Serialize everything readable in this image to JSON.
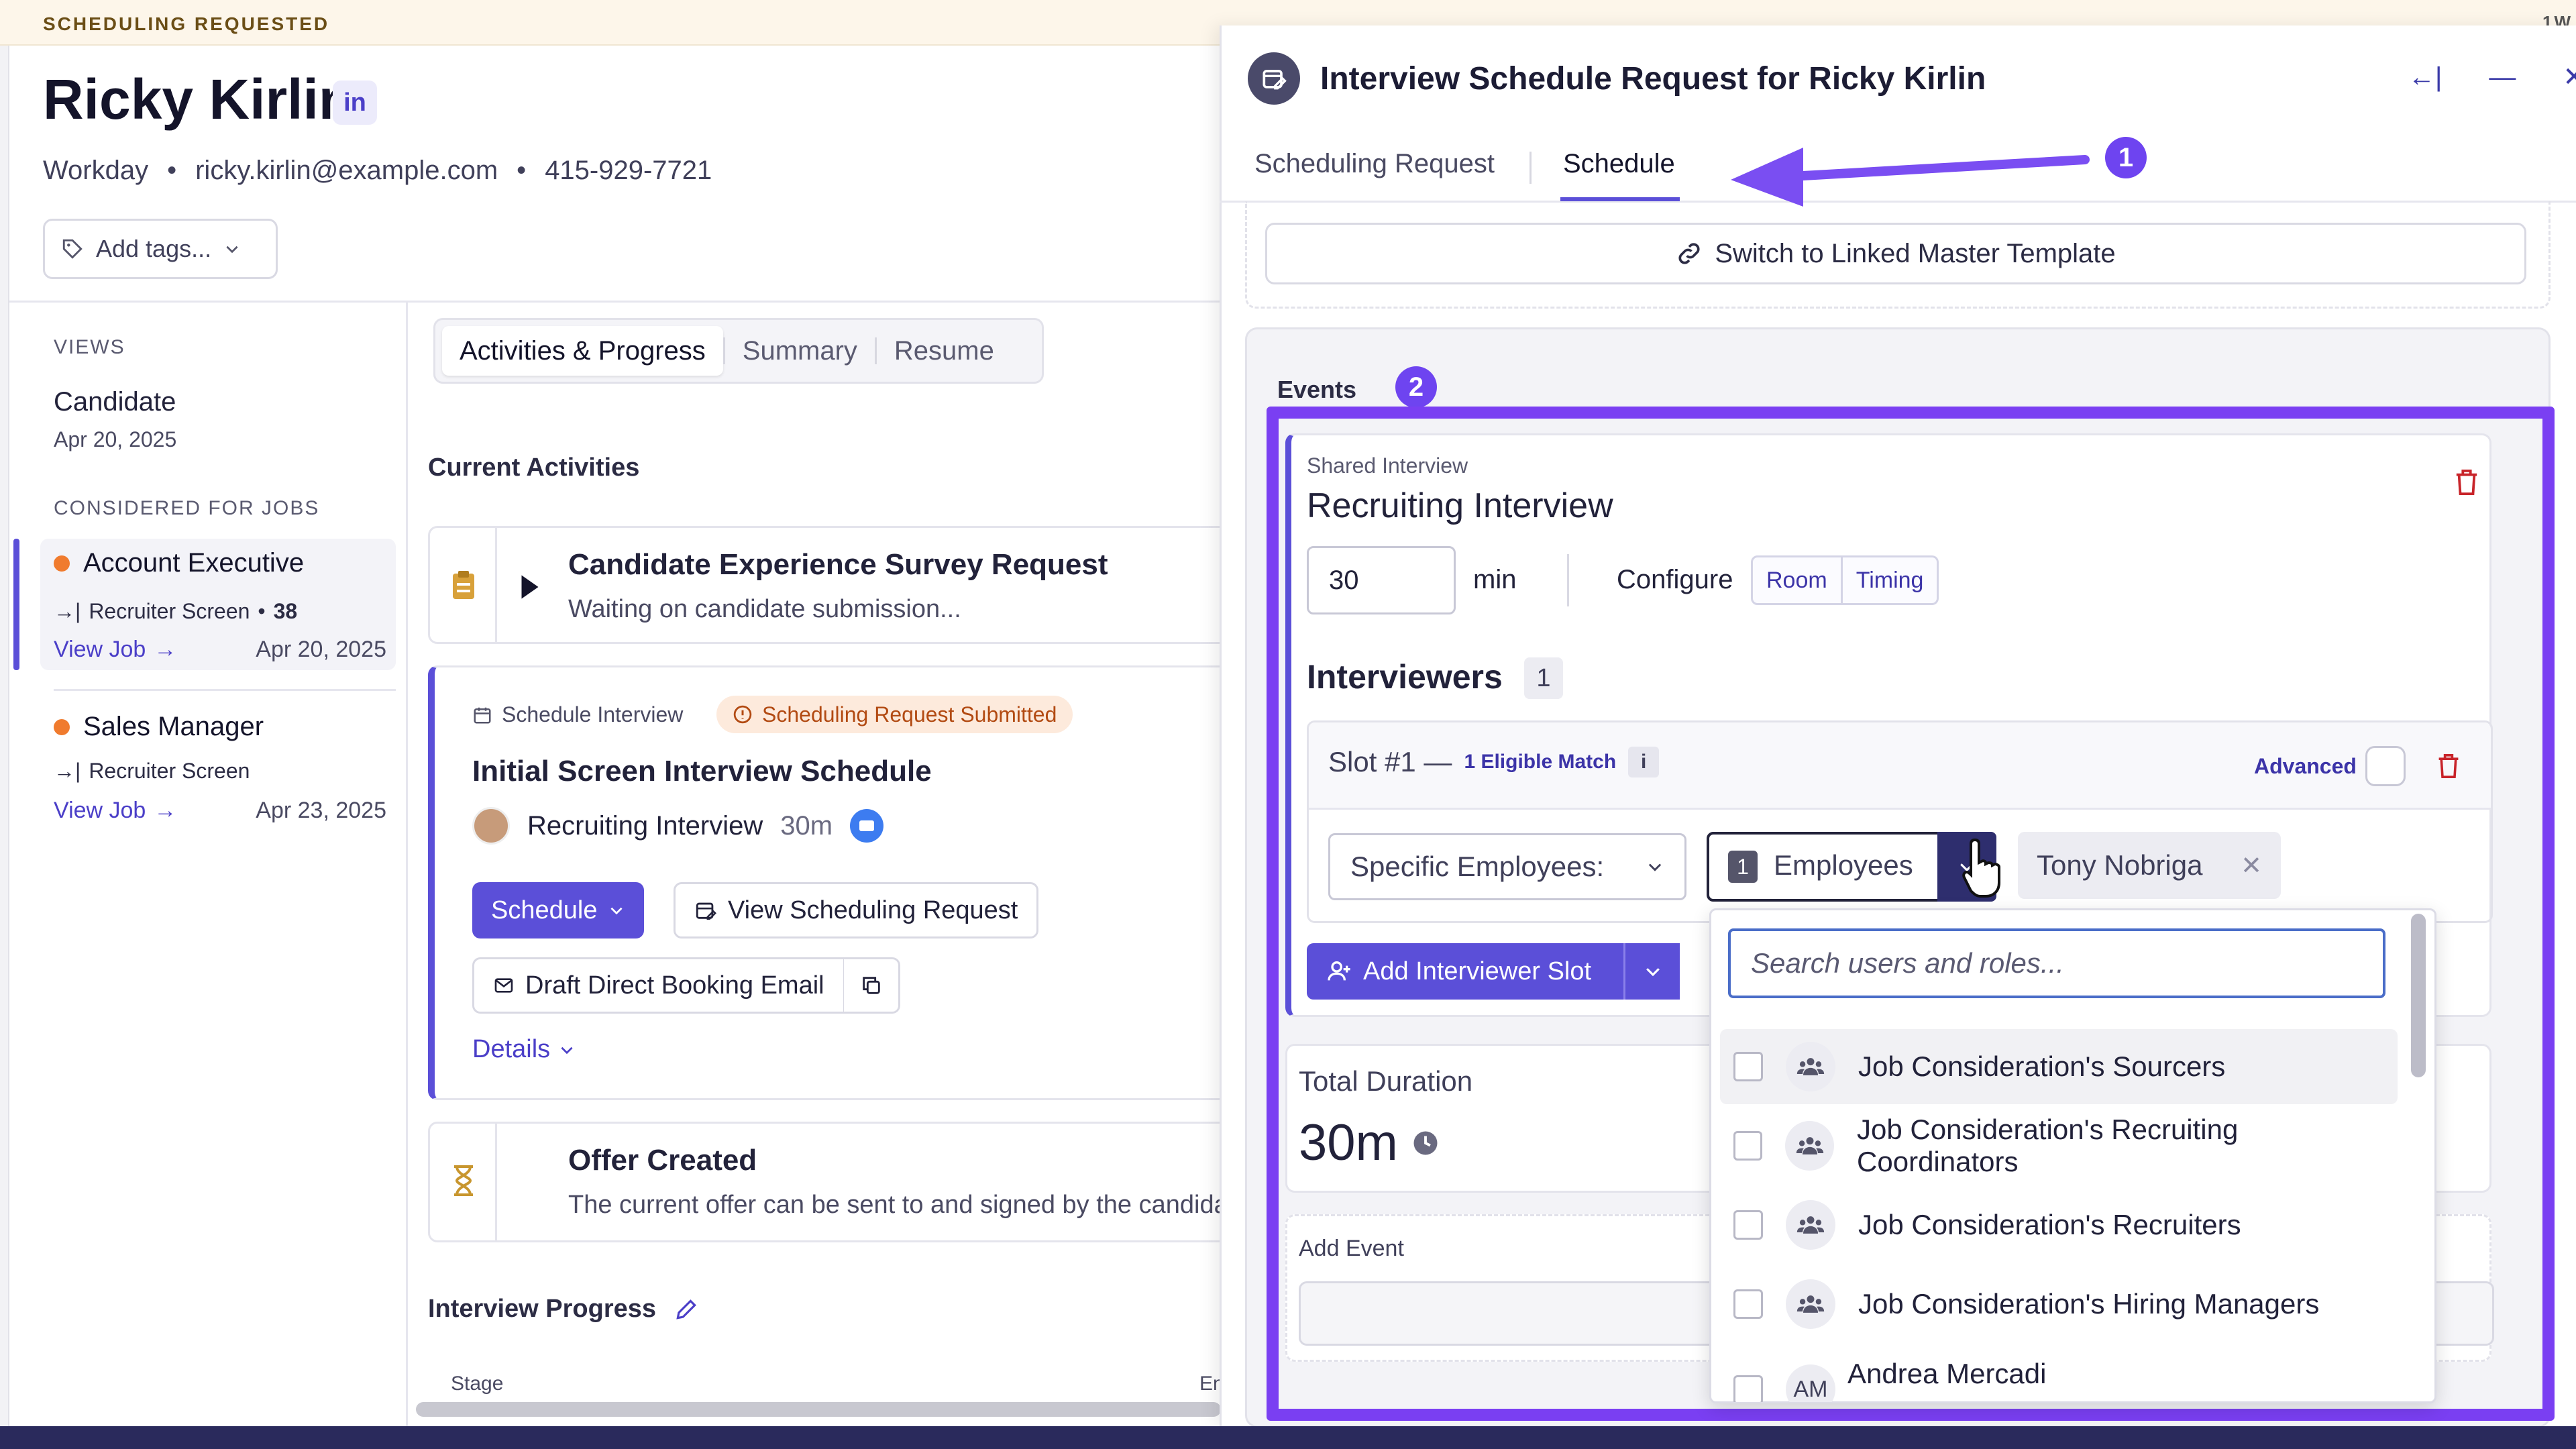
{
  "banner": {
    "label": "SCHEDULING REQUESTED",
    "corner": "1W"
  },
  "candidate": {
    "name": "Ricky Kirlin",
    "linkedin": "in",
    "source": "Workday",
    "email": "ricky.kirlin@example.com",
    "phone": "415-929-7721",
    "add_tags": "Add tags..."
  },
  "sidebar": {
    "views_heading": "VIEWS",
    "view_item": {
      "label": "Candidate",
      "date": "Apr 20, 2025"
    },
    "jobs_heading": "CONSIDERED FOR JOBS",
    "jobs": [
      {
        "title": "Account Executive",
        "stage": "Recruiter Screen",
        "score": "38",
        "view": "View Job",
        "date": "Apr 20, 2025"
      },
      {
        "title": "Sales Manager",
        "stage": "Recruiter Screen",
        "view": "View Job",
        "date": "Apr 23, 2025"
      }
    ]
  },
  "main": {
    "tabs": [
      "Activities & Progress",
      "Summary",
      "Resume"
    ],
    "current_activities": "Current Activities",
    "survey": {
      "title": "Candidate Experience Survey Request",
      "sub": "Waiting on candidate submission..."
    },
    "schedule_card": {
      "kind": "Schedule Interview",
      "badge": "Scheduling Request Submitted",
      "title": "Initial Screen Interview Schedule",
      "interview": "Recruiting Interview",
      "duration": "30m",
      "schedule_btn": "Schedule",
      "view_btn": "View Scheduling Request",
      "draft_btn": "Draft Direct Booking Email",
      "details": "Details"
    },
    "offer": {
      "title": "Offer Created",
      "sub": "The current offer can be sent to and signed by the candidate"
    },
    "interview_progress": "Interview Progress",
    "stage_col": "Stage",
    "en_col": "En"
  },
  "panel": {
    "title": "Interview Schedule Request for Ricky Kirlin",
    "tabs": [
      "Scheduling Request",
      "Schedule"
    ],
    "switch_btn": "Switch to Linked Master Template",
    "events_label": "Events",
    "annotations": [
      "1",
      "2"
    ],
    "event": {
      "kind": "Shared Interview",
      "name": "Recruiting Interview",
      "minutes": "30",
      "min_label": "min",
      "configure": "Configure",
      "room": "Room",
      "timing": "Timing",
      "interviewers_label": "Interviewers",
      "interviewers_count": "1",
      "slot_label": "Slot #1 —",
      "eligible": "1 Eligible Match",
      "info": "i",
      "advanced": "Advanced",
      "type_select": "Specific Employees:",
      "emp_count": "1",
      "emp_label": "Employees",
      "chip": "Tony Nobriga",
      "add_slot": "Add Interviewer Slot"
    },
    "total_label": "Total Duration",
    "total_value": "30m",
    "add_event": "Add Event",
    "dropdown": {
      "placeholder": "Search users and roles...",
      "options": [
        {
          "label": "Job Consideration's Sourcers",
          "icon": "group-icon"
        },
        {
          "label": "Job Consideration's Recruiting Coordinators",
          "icon": "group-icon"
        },
        {
          "label": "Job Consideration's Recruiters",
          "icon": "group-icon"
        },
        {
          "label": "Job Consideration's Hiring Managers",
          "icon": "group-icon"
        },
        {
          "label": "Andrea Mercadi",
          "avatar": "AM"
        }
      ]
    }
  },
  "colors": {
    "accent": "#5b4fd8",
    "annotation": "#6e44f0",
    "badge": "#b24a12",
    "job_dot": "#f07b2e"
  }
}
